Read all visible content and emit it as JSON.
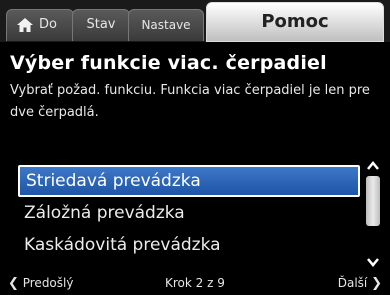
{
  "tabs": {
    "home_label": "Do",
    "status_label": "Stav",
    "settings_label": "Nastave",
    "help_label": "Pomoc"
  },
  "header": {
    "title": "Výber funkcie viac. čerpadiel",
    "description": "Vybrať požad. funkciu. Funkcia viac čerpadiel je len pre dve čerpadlá."
  },
  "list": {
    "items": [
      {
        "label": "Striedavá prevádzka",
        "selected": true
      },
      {
        "label": "Záložná prevádzka",
        "selected": false
      },
      {
        "label": "Kaskádovitá prevádzka",
        "selected": false
      }
    ]
  },
  "footer": {
    "prev_label": "Predošlý",
    "step_label": "Krok 2 z 9",
    "next_label": "Ďalší"
  },
  "colors": {
    "selection": "#2a64b8",
    "active_tab": "#e8e8e8",
    "background": "#000000"
  },
  "icons": {
    "home": "home-icon",
    "prev": "chevron-left-icon",
    "next": "chevron-right-icon",
    "scroll_up": "chevron-up-icon",
    "scroll_down": "chevron-down-icon"
  }
}
